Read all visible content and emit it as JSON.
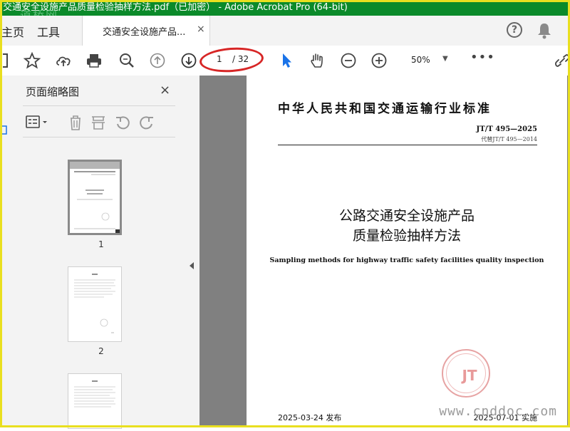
{
  "window": {
    "title": "交通安全设施产品质量检验抽样方法.pdf（已加密） - Adobe Acrobat Pro (64-bit)",
    "watermark": "道桥网"
  },
  "tabs": {
    "home": "主页",
    "tools": "工具",
    "document": "交通安全设施产品...",
    "close": "×"
  },
  "toolbar": {
    "page_current": "1",
    "page_total": "/ 32",
    "zoom": "50%",
    "more": "•••"
  },
  "thumbnails": {
    "title": "页面缩略图",
    "close": "×",
    "pages": [
      {
        "label": "1"
      },
      {
        "label": "2"
      }
    ]
  },
  "document": {
    "header_title": "中华人民共和国交通运输行业标准",
    "standard_code": "JT/T 495—2025",
    "replaces": "代替JT/T 495—2014",
    "title_line1": "公路交通安全设施产品",
    "title_line2": "质量检验抽样方法",
    "english_title": "Sampling methods for highway traffic safety facilities quality inspection",
    "seal_text": "JT",
    "publish_date": "2025-03-24 发布",
    "implement_date": "2025-07-01 实施",
    "watermark": "www.cnddoc.com"
  },
  "colors": {
    "titlebar": "#0b8a2a",
    "annotation_ring": "#d72626",
    "select_arrow": "#1a73e8",
    "frame": "#e9df1f"
  }
}
